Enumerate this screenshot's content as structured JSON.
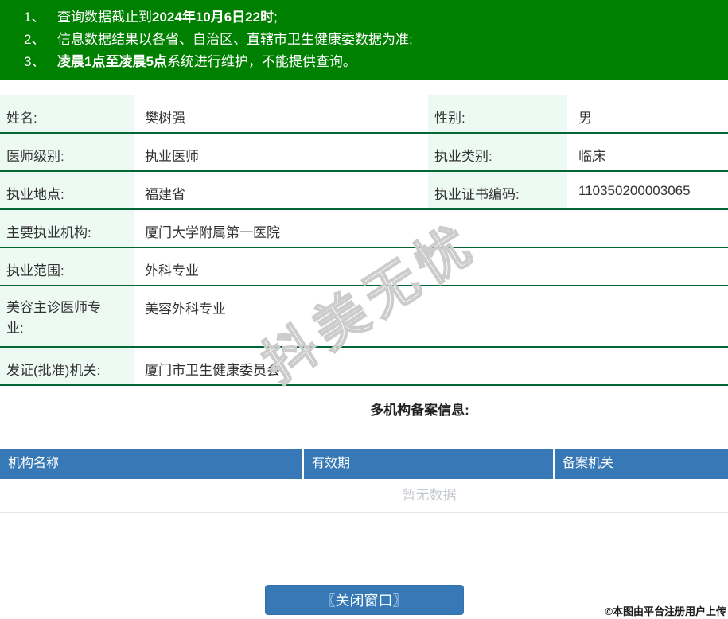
{
  "colors": {
    "banner_green": "#008000",
    "row_border_green": "#006633",
    "label_mint": "#edfaf3",
    "table_header_blue": "#3779b7",
    "button_blue": "#3779b7",
    "empty_text_gray": "#c4c9cf"
  },
  "notices": {
    "items": [
      {
        "num": "1、",
        "pre": "查询数据截止到",
        "bold": "2024年10月6日22时",
        "post": ";"
      },
      {
        "num": "2、",
        "pre": "信息数据结果以各省、自治区、直辖市卫生健康委数据为准;",
        "bold": "",
        "post": ""
      },
      {
        "num": "3、",
        "pre": "",
        "bold": "凌晨1点至凌晨5点",
        "post": "系统进行维护，不能提供查询。"
      }
    ]
  },
  "info_table": {
    "rows": [
      {
        "l1": "姓名:",
        "v1": "樊树强",
        "l2": "性别:",
        "v2": "男"
      },
      {
        "l1": "医师级别:",
        "v1": "执业医师",
        "l2": "执业类别:",
        "v2": "临床"
      },
      {
        "l1": "执业地点:",
        "v1": "福建省",
        "l2": "执业证书编码:",
        "v2": "110350200003065"
      },
      {
        "l1": "主要执业机构:",
        "v1": "厦门大学附属第一医院"
      },
      {
        "l1": "执业范围:",
        "v1": "外科专业"
      },
      {
        "l1": "美容主诊医师专业:",
        "v1": "美容外科专业"
      },
      {
        "l1": "发证(批准)机关:",
        "v1": "厦门市卫生健康委员会"
      }
    ]
  },
  "section": {
    "title": "多机构备案信息:"
  },
  "records_table": {
    "columns": [
      "机构名称",
      "有效期",
      "备案机关"
    ],
    "empty_text": "暂无数据"
  },
  "actions": {
    "close_label": "〖关闭窗口〗"
  },
  "watermark": {
    "text": "抖美无忧"
  },
  "stamp": {
    "text": "©本图由平台注册用户上传"
  }
}
